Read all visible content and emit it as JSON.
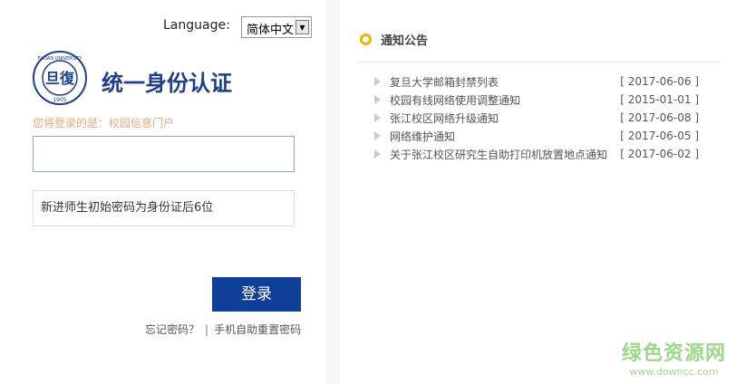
{
  "language": {
    "label": "Language:",
    "selected": "简体中文"
  },
  "logo": {
    "text": "FUDAN UNIVERSITY 1905"
  },
  "title": "统一身份认证",
  "hint": "您将登录的是：校园信息门户",
  "username": {
    "value": ""
  },
  "password": {
    "placeholder": "新进师生初始密码为身份证后6位"
  },
  "login_label": "登录",
  "links": {
    "forgot": "忘记密码？",
    "sep": "|",
    "reset": "手机自助重置密码"
  },
  "notices": {
    "title": "通知公告",
    "items": [
      {
        "text": "复旦大学邮箱封禁列表",
        "date": "[ 2017-06-06 ]"
      },
      {
        "text": "校园有线网络使用调整通知",
        "date": "[ 2015-01-01 ]"
      },
      {
        "text": "张江校区网络升级通知",
        "date": "[ 2017-06-08 ]"
      },
      {
        "text": "网络维护通知",
        "date": "[ 2017-06-05 ]"
      },
      {
        "text": "关于张江校区研究生自助打印机放置地点通知",
        "date": "[ 2017-06-02 ]"
      }
    ]
  },
  "watermark": {
    "name": "绿色资源网",
    "url": "www.downcc.com"
  }
}
